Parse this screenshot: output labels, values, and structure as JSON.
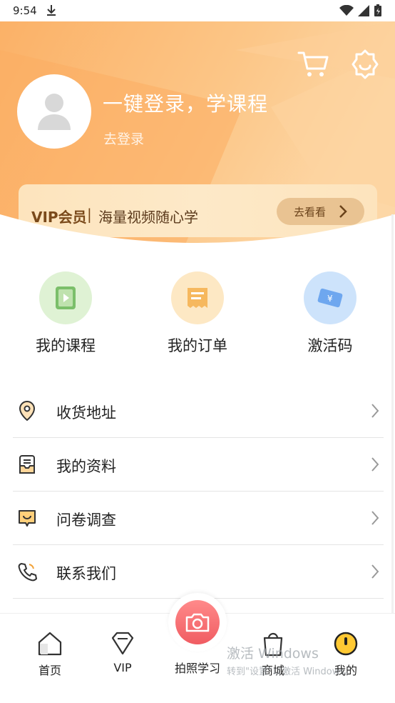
{
  "status_bar": {
    "time": "9:54"
  },
  "header": {
    "login_title": "一键登录，学课程",
    "login_link": "去登录"
  },
  "vip": {
    "title": "VIP会员",
    "separator": "|",
    "subtitle": "海量视频随心学",
    "button_label": "去看看"
  },
  "quick_actions": [
    {
      "label": "我的课程",
      "icon": "course-icon",
      "color": "#dff2d4"
    },
    {
      "label": "我的订单",
      "icon": "order-icon",
      "color": "#fde8c4"
    },
    {
      "label": "激活码",
      "icon": "activation-code-icon",
      "color": "#cde3fb"
    }
  ],
  "menu": [
    {
      "label": "收货地址",
      "icon": "location-pin-icon"
    },
    {
      "label": "我的资料",
      "icon": "profile-tray-icon"
    },
    {
      "label": "问卷调查",
      "icon": "survey-icon"
    },
    {
      "label": "联系我们",
      "icon": "phone-icon"
    }
  ],
  "bottom_nav": {
    "home": "首页",
    "vip": "VIP",
    "camera": "拍照学习",
    "shop": "商城",
    "mine": "我的"
  },
  "watermark": {
    "title": "激活 Windows",
    "subtitle": "转到\"设置\"以激活 Windows。"
  },
  "colors": {
    "header_orange": "#fbb56c",
    "vip_card": "#fde4bd",
    "camera_red": "#f05c62"
  }
}
